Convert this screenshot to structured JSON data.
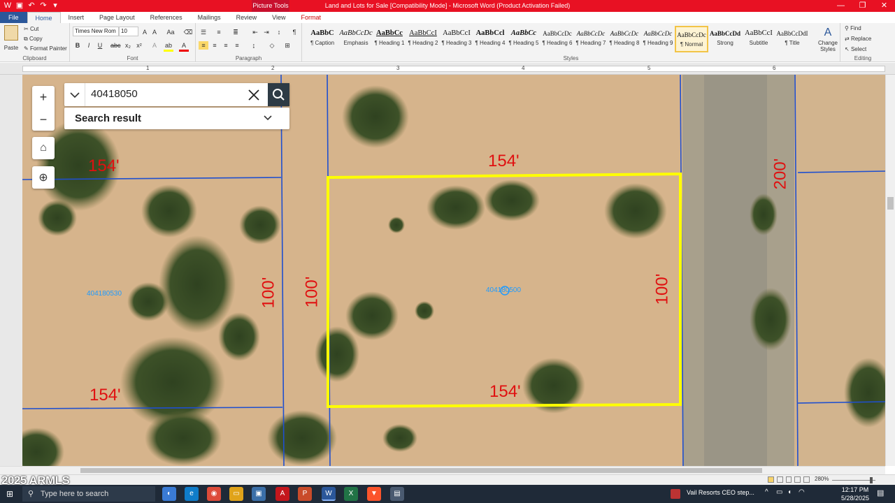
{
  "window": {
    "title": "Land and Lots for Sale [Compatibility Mode] - Microsoft Word (Product Activation Failed)",
    "context_tab": "Picture Tools",
    "controls": [
      "minimize",
      "restore",
      "close"
    ]
  },
  "ribbon_tabs": [
    "File",
    "Home",
    "Insert",
    "Page Layout",
    "References",
    "Mailings",
    "Review",
    "View",
    "Format"
  ],
  "active_tab": "Home",
  "clipboard": {
    "paste": "Paste",
    "cut": "Cut",
    "copy": "Copy",
    "format_painter": "Format Painter",
    "label": "Clipboard"
  },
  "font": {
    "name": "Times New Rom",
    "size": "10",
    "label": "Font"
  },
  "paragraph": {
    "label": "Paragraph"
  },
  "styles": {
    "label": "Styles",
    "change_styles": "Change Styles",
    "items": [
      {
        "preview": "AaBbC",
        "name": "¶ Caption"
      },
      {
        "preview": "AaBbCcDc",
        "name": "Emphasis"
      },
      {
        "preview": "AaBbCc",
        "name": "¶ Heading 1"
      },
      {
        "preview": "AaBbCcI",
        "name": "¶ Heading 2"
      },
      {
        "preview": "AaBbCcI",
        "name": "¶ Heading 3"
      },
      {
        "preview": "AaBbCcl",
        "name": "¶ Heading 4"
      },
      {
        "preview": "AaBbCc",
        "name": "¶ Heading 5"
      },
      {
        "preview": "AaBbCcDc",
        "name": "¶ Heading 6"
      },
      {
        "preview": "AaBbCcDc",
        "name": "¶ Heading 7"
      },
      {
        "preview": "AaBbCcDc",
        "name": "¶ Heading 8"
      },
      {
        "preview": "AaBbCcDc",
        "name": "¶ Heading 9"
      },
      {
        "preview": "AaBbCcDc",
        "name": "¶ Normal"
      },
      {
        "preview": "AaBbCcDd",
        "name": "Strong"
      },
      {
        "preview": "AaBbCcI",
        "name": "Subtitle"
      },
      {
        "preview": "AaBbCcDdI",
        "name": "¶ Title"
      }
    ],
    "selected": "¶ Normal"
  },
  "editing": {
    "find": "Find",
    "replace": "Replace",
    "select": "Select",
    "label": "Editing"
  },
  "ruler_numbers": [
    "1",
    "2",
    "3",
    "4",
    "5",
    "6"
  ],
  "map": {
    "search_value": "40418050",
    "search_result_label": "Search result",
    "parcels": {
      "left": "404180530",
      "center": "404180500"
    },
    "dimensions": {
      "top": "154'",
      "bottom": "154'",
      "right": "100'",
      "left": "100'",
      "left_parcel_right": "100'",
      "left_parcel_top": "154'",
      "left_parcel_bottom": "154'",
      "road": "200'"
    },
    "colors": {
      "highlight": "#ffff00",
      "lot_lines": "#1f4fcf",
      "dimension_text": "#e01010",
      "parcel_label": "#1e9bff"
    }
  },
  "status": {
    "zoom": "280%"
  },
  "watermark": "2025 ARMLS",
  "taskbar": {
    "search_placeholder": "Type here to search",
    "news": "Vail Resorts CEO step...",
    "time": "12:17 PM",
    "date": "5/28/2025"
  }
}
